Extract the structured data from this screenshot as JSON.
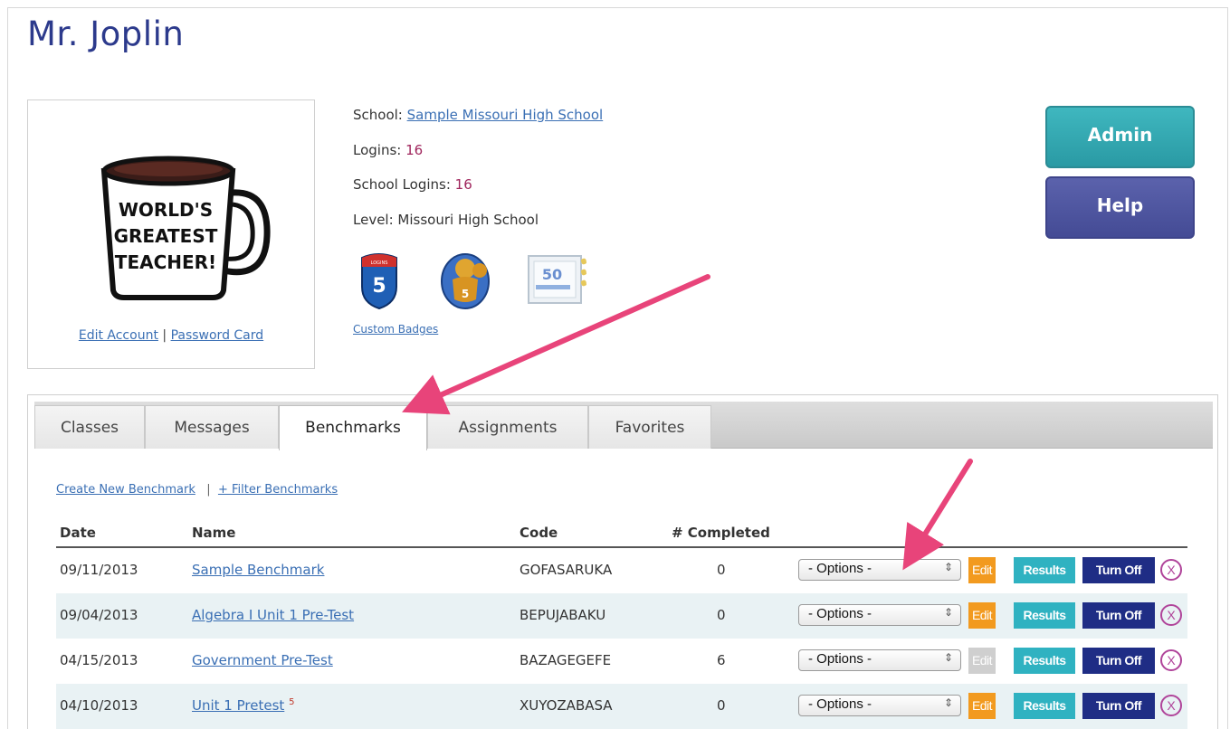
{
  "header": {
    "title": "Mr. Joplin"
  },
  "profile": {
    "mug_text": [
      "WORLD'S",
      "GREATEST",
      "TEACHER!"
    ],
    "edit_account": "Edit Account",
    "separator": "|",
    "password_card": "Password Card"
  },
  "info": {
    "school_label": "School: ",
    "school_value": "Sample Missouri High School",
    "logins_label": "Logins: ",
    "logins_value": "16",
    "school_logins_label": "School Logins: ",
    "school_logins_value": "16",
    "level_label": "Level: ",
    "level_value": "Missouri High School",
    "badges": [
      {
        "icon": "interstate-shield-badge-icon",
        "top_text": "LOGINS",
        "number": "5"
      },
      {
        "icon": "mascot-badge-icon",
        "number": "5"
      },
      {
        "icon": "certificate-badge-icon",
        "number": "50"
      }
    ],
    "custom_badges": "Custom Badges"
  },
  "buttons": {
    "admin": "Admin",
    "help": "Help"
  },
  "tabs": [
    {
      "label": "Classes",
      "active": false
    },
    {
      "label": "Messages",
      "active": false
    },
    {
      "label": "Benchmarks",
      "active": true
    },
    {
      "label": "Assignments",
      "active": false
    },
    {
      "label": "Favorites",
      "active": false
    }
  ],
  "actions": {
    "create": "Create New Benchmark",
    "separator": "|",
    "filter": "+ Filter Benchmarks"
  },
  "table": {
    "columns": [
      "Date",
      "Name",
      "Code",
      "# Completed"
    ],
    "rows": [
      {
        "date": "09/11/2013",
        "name": "Sample Benchmark",
        "sup": "",
        "code": "GOFASARUKA",
        "completed": "0",
        "edit_enabled": true
      },
      {
        "date": "09/04/2013",
        "name": "Algebra I Unit 1 Pre-Test",
        "sup": "",
        "code": "BEPUJABAKU",
        "completed": "0",
        "edit_enabled": true
      },
      {
        "date": "04/15/2013",
        "name": "Government Pre-Test",
        "sup": "",
        "code": "BAZAGEGEFE",
        "completed": "6",
        "edit_enabled": false
      },
      {
        "date": "04/10/2013",
        "name": "Unit 1 Pretest",
        "sup": "5",
        "code": "XUYOZABASA",
        "completed": "0",
        "edit_enabled": true
      }
    ],
    "options_label": "- Options -",
    "edit_label": "Edit",
    "results_label": "Results",
    "turnoff_label": "Turn Off",
    "delete_label": "X"
  },
  "colors": {
    "title": "#2c3a8c",
    "admin": "#34a9b2",
    "help": "#4d549e",
    "edit": "#f29a1f",
    "results": "#2fb2c1",
    "turnoff": "#1f2d85",
    "annotation_arrow": "#e8447a"
  }
}
